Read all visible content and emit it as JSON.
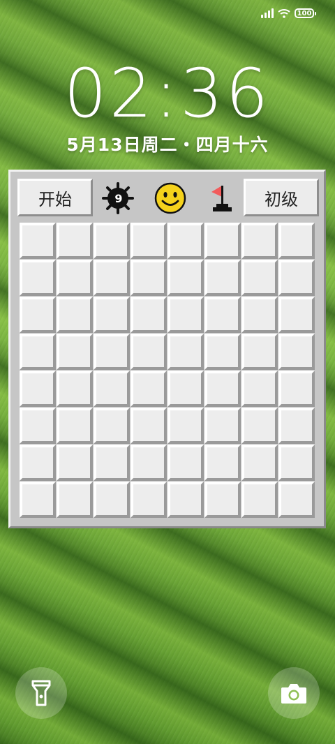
{
  "status_bar": {
    "battery": "100",
    "icons": [
      "signal-icon",
      "wifi-icon",
      "battery-icon"
    ]
  },
  "lockscreen": {
    "time": "02:36",
    "date": "5月13日周二・四月十六"
  },
  "game": {
    "start_label": "开始",
    "level_label": "初级",
    "mine_count": "9",
    "face": "smiley-icon",
    "flag": "flag-icon",
    "rows": 8,
    "cols": 8
  },
  "shortcuts": {
    "left": "flashlight-icon",
    "right": "camera-icon"
  },
  "colors": {
    "panel": "#c6c6c6",
    "cell": "#ededed",
    "flag_red": "#f25b5b",
    "smiley_yellow": "#f5d21c"
  }
}
